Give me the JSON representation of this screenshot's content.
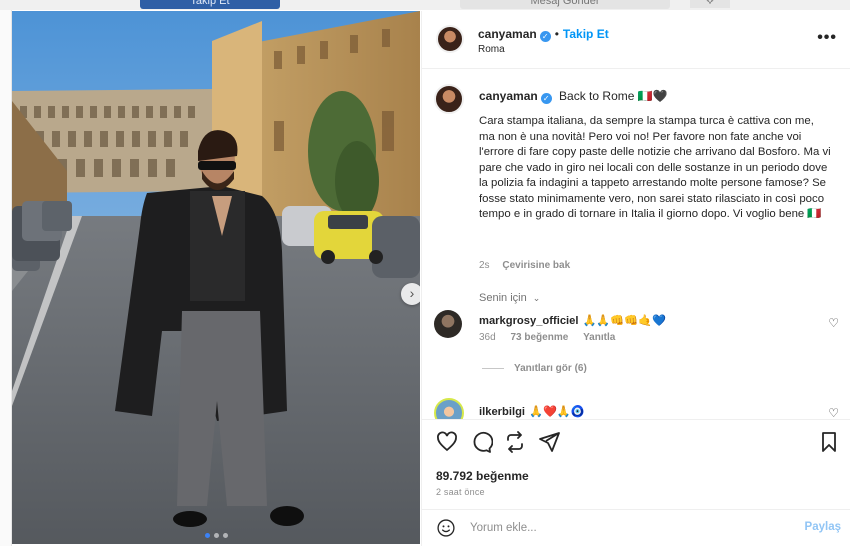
{
  "background": {
    "button_1": "Takip Et",
    "button_2": "Mesaj Gönder"
  },
  "post": {
    "username": "canyaman",
    "follow_label": "Takip Et",
    "location": "Roma",
    "more_label": "•••",
    "image_dots": 3,
    "active_dot": 0
  },
  "caption": {
    "username": "canyaman",
    "headline": "Back to Rome 🇮🇹🖤",
    "text": "Cara stampa italiana, da sempre la stampa turca è cattiva con me, ma non è una novità! Pero voi no! Per favore non fate anche voi l'errore di fare copy paste delle notizie che arrivano dal Bosforo. Ma vi pare che vado in giro nei locali con delle sostanze in un periodo dove la polizia fa indagini a tappeto arrestando molte persone famose? Se fosse stato minimamente vero, non sarei stato rilasciato in così poco tempo e in grado di tornare in Italia il giorno dopo. Vi voglio bene 🇮🇹",
    "age": "2s",
    "translate_label": "Çevirisine bak"
  },
  "for_you_label": "Senin için",
  "comments": [
    {
      "username": "markgrosy_officiel",
      "emoji_text": "🙏🙏👊👊🤙💙",
      "age": "36d",
      "likes": "73 beğenme",
      "reply_label": "Yanıtla",
      "view_replies": "Yanıtları gör (6)"
    },
    {
      "username": "ilkerbilgi",
      "emoji_text": "🙏❤️🙏🧿"
    }
  ],
  "actions": {
    "like_icon": "heart-icon",
    "comment_icon": "comment-icon",
    "share_icon": "repost-icon",
    "send_icon": "send-icon",
    "save_icon": "bookmark-icon"
  },
  "likes_count": "89.792 beğenme",
  "timestamp": "2 saat önce",
  "composer": {
    "placeholder": "Yorum ekle...",
    "post_label": "Paylaş"
  },
  "colors": {
    "accent": "#0095f6",
    "post_disabled": "#91c5f5",
    "verified": "#3897f0"
  }
}
